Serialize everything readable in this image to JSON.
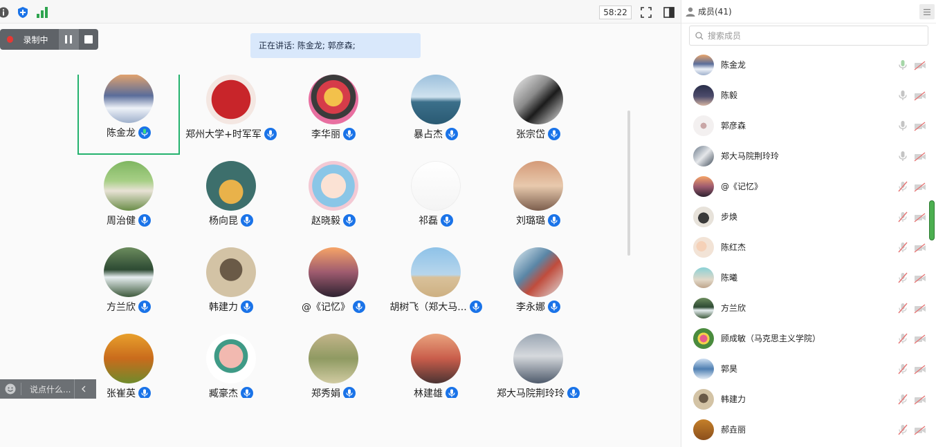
{
  "toolbar": {
    "timer": "58:22",
    "icons": [
      "info-icon",
      "shield-plus-icon",
      "signal-icon",
      "fullscreen-icon",
      "panel-toggle-icon"
    ]
  },
  "recording": {
    "label": "录制中",
    "color": "#e53935"
  },
  "speaking": {
    "text": "正在讲话: 陈金龙; 郭彦森;"
  },
  "participants": [
    {
      "name": "陈金龙",
      "active": true,
      "mic": "green"
    },
    {
      "name": "郑州大学+时军军"
    },
    {
      "name": "李华丽"
    },
    {
      "name": "暴占杰"
    },
    {
      "name": "张宗岱"
    },
    {
      "name": "周治健"
    },
    {
      "name": "杨向昆"
    },
    {
      "name": "赵晓毅"
    },
    {
      "name": "祁磊"
    },
    {
      "name": "刘璐璐"
    },
    {
      "name": "方兰欣"
    },
    {
      "name": "韩建力"
    },
    {
      "name": "@《记忆》"
    },
    {
      "name": "胡树飞（郑大马..."
    },
    {
      "name": "李永娜"
    },
    {
      "name": "张崔英"
    },
    {
      "name": "臧豪杰"
    },
    {
      "name": "郑秀娟"
    },
    {
      "name": "林建雄"
    },
    {
      "name": "郑大马院荆玲玲"
    }
  ],
  "chat": {
    "placeholder": "说点什么..."
  },
  "panel": {
    "title": "成员(41)",
    "search_placeholder": "搜索成员",
    "members": [
      {
        "name": "陈金龙",
        "mic": "active"
      },
      {
        "name": "陈毅",
        "mic": "on"
      },
      {
        "name": "郭彦森",
        "mic": "on"
      },
      {
        "name": "郑大马院荆玲玲",
        "mic": "on"
      },
      {
        "name": "@《记忆》",
        "mic": "muted"
      },
      {
        "name": "步焕",
        "mic": "muted"
      },
      {
        "name": "陈红杰",
        "mic": "muted"
      },
      {
        "name": "陈曦",
        "mic": "muted"
      },
      {
        "name": "方兰欣",
        "mic": "muted"
      },
      {
        "name": "顾成敏（马克思主义学院）",
        "mic": "muted"
      },
      {
        "name": "郭昊",
        "mic": "muted"
      },
      {
        "name": "韩建力",
        "mic": "muted"
      },
      {
        "name": "郝垚丽",
        "mic": "muted"
      }
    ]
  },
  "colors": {
    "accent": "#1a73e8",
    "active_border": "#23b26d",
    "banner_bg": "#d9e8fb",
    "muted_red": "#e57373"
  }
}
